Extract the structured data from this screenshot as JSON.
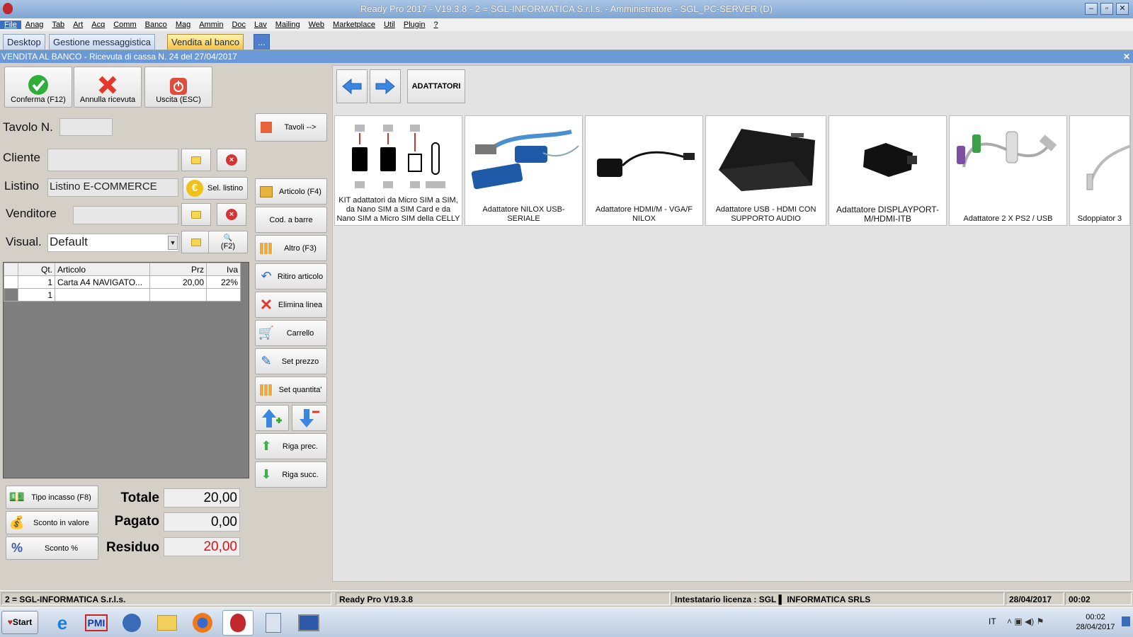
{
  "titlebar": {
    "title": "Ready Pro 2017 - V19.3.8 - 2 = SGL-INFORMATICA S.r.l.s. - Amministratore - SGL_PC-SERVER (D)",
    "minimize": "–",
    "restore": "▫",
    "close": "✕"
  },
  "menu": [
    "File",
    "Anag",
    "Tab",
    "Art",
    "Acq",
    "Comm",
    "Banco",
    "Mag",
    "Ammin",
    "Doc",
    "Lav",
    "Mailing",
    "Web",
    "Marketplace",
    "Util",
    "Plugin",
    "?"
  ],
  "tabs": {
    "desktop": "Desktop",
    "messaggistica": "Gestione messaggistica",
    "vendita": "Vendita al banco",
    "more": "..."
  },
  "doc": {
    "title": "VENDITA AL BANCO - Ricevuta di cassa N. 24 del 27/04/2017",
    "close": "✕"
  },
  "toolbar": {
    "confirm": "Conferma (F12)",
    "cancel": "Annulla ricevuta",
    "exit": "Uscita (ESC)"
  },
  "form": {
    "tavolo_label": "Tavolo N.",
    "tavolo_value": "",
    "tavoli_button": "Tavoli -->",
    "cliente_label": "Cliente",
    "cliente_value": "",
    "listino_label": "Listino",
    "listino_value": "Listino E-COMMERCE",
    "sel_listino": "Sel. listino",
    "venditore_label": "Venditore",
    "venditore_value": "",
    "visual_label": "Visual.",
    "visual_value": "Default",
    "f2": "(F2)"
  },
  "grid": {
    "headers": [
      "Qt.",
      "Articolo",
      "Prz",
      "Iva"
    ],
    "rows": [
      [
        "1",
        "Carta A4 NAVIGATO...",
        "20,00",
        "22%"
      ],
      [
        "1",
        "",
        "",
        ""
      ]
    ]
  },
  "side_buttons": {
    "articolo": "Articolo (F4)",
    "barcode": "Cod. a barre",
    "altro": "Altro (F3)",
    "ritiro": "Ritiro articolo",
    "elimina": "Elimina linea",
    "carrello": "Carrello",
    "set_prezzo": "Set prezzo",
    "set_quantita": "Set quantita'",
    "riga_prec": "Riga prec.",
    "riga_succ": "Riga succ."
  },
  "totals": {
    "tipo_incasso": "Tipo incasso (F8)",
    "sconto_valore": "Sconto in valore",
    "sconto_perc": "Sconto %",
    "totale_label": "Totale",
    "totale": "20,00",
    "pagato_label": "Pagato",
    "pagato": "0,00",
    "residuo_label": "Residuo",
    "residuo": "20,00",
    "residuo_color": "#e01010"
  },
  "catalog": {
    "category": "ADATTATORI",
    "products": [
      {
        "name": "KIT adattatori da Micro SIM a SIM, da Nano SIM a SIM Card e da Nano SIM a Micro SIM della CELLY"
      },
      {
        "name": "Adattatore NILOX USB-SERIALE"
      },
      {
        "name": "Adattatore  HDMI/M - VGA/F NILOX"
      },
      {
        "name": "Adattatore USB - HDMI CON SUPPORTO AUDIO"
      },
      {
        "name": "Adattatore DISPLAYPORT-M/HDMI-ITB"
      },
      {
        "name": "Adattatore 2 X PS2 / USB"
      },
      {
        "name": "Sdoppiator 3"
      }
    ]
  },
  "status": {
    "company": "2 = SGL-INFORMATICA S.r.l.s.",
    "version": "Ready Pro V19.3.8",
    "license": "Intestatario licenza : SGL ▌ INFORMATICA SRLS",
    "date": "28/04/2017",
    "time": "00:02"
  },
  "taskbar": {
    "start": "Start",
    "lang": "IT",
    "clock_time": "00:02",
    "clock_date": "28/04/2017"
  }
}
